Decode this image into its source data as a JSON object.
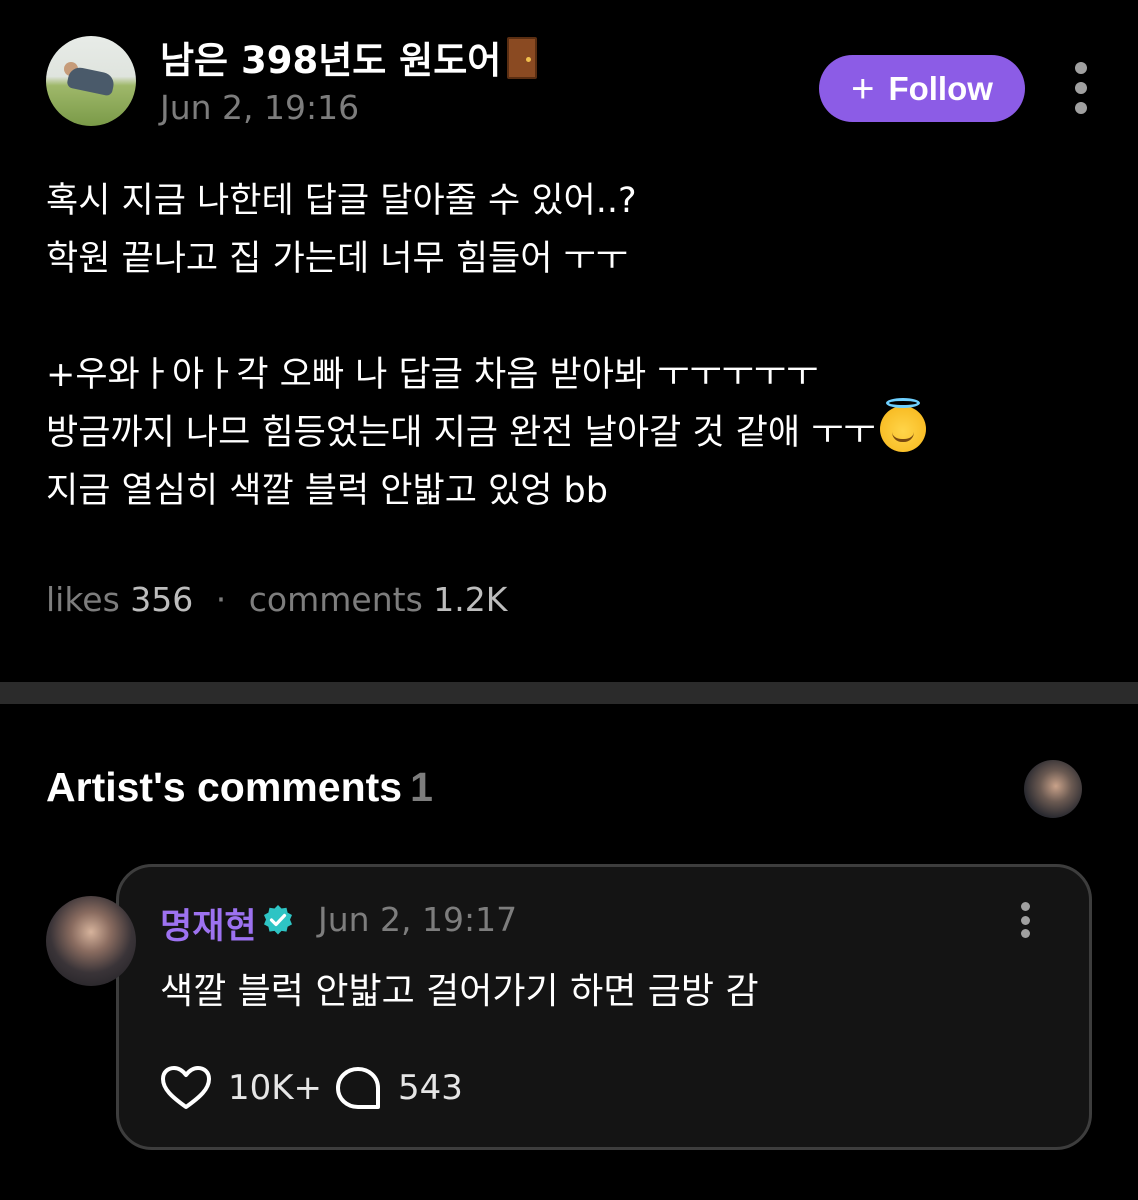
{
  "post": {
    "author": {
      "name": "남은 398년도 원도어",
      "emoji_icon": "door-emoji-icon"
    },
    "date": "Jun 2, 19:16",
    "follow_label": "Follow",
    "body": {
      "line1": "혹시 지금 나한테 답글 달아줄 수 있어..?",
      "line2": "학원 끝나고 집 가는데 너무 힘들어 ㅜㅜ",
      "line3": "+우와ㅏ아ㅏ각 오빠 나 답글 차음 받아봐 ㅜㅜㅜㅜㅜ",
      "line4": "방금까지 나므 힘등었는대 지금 완전 날아갈 것 같애 ㅜㅜ",
      "line4_emoji": "smiling-face-with-halo-emoji",
      "line5": "지금 열심히 색깔 블럭 안밟고 있엉 bb"
    },
    "stats": {
      "likes_label": "likes",
      "likes_count": "356",
      "separator": "·",
      "comments_label": "comments",
      "comments_count": "1.2K"
    }
  },
  "artist_comments": {
    "title": "Artist's comments",
    "count": "1"
  },
  "comment": {
    "author": "명재현",
    "verified_icon": "verified-badge-icon",
    "date": "Jun 2, 19:17",
    "text": "색깔 블럭 안밟고 걸어가기 하면 금방 감",
    "likes": "10K+",
    "replies": "543"
  },
  "colors": {
    "background": "#000000",
    "accent_purple": "#8c5ce6",
    "author_purple": "#9d72f0",
    "verified_teal": "#2ec4c4",
    "muted_text": "#7d7d7d",
    "divider": "#2b2b2b"
  }
}
